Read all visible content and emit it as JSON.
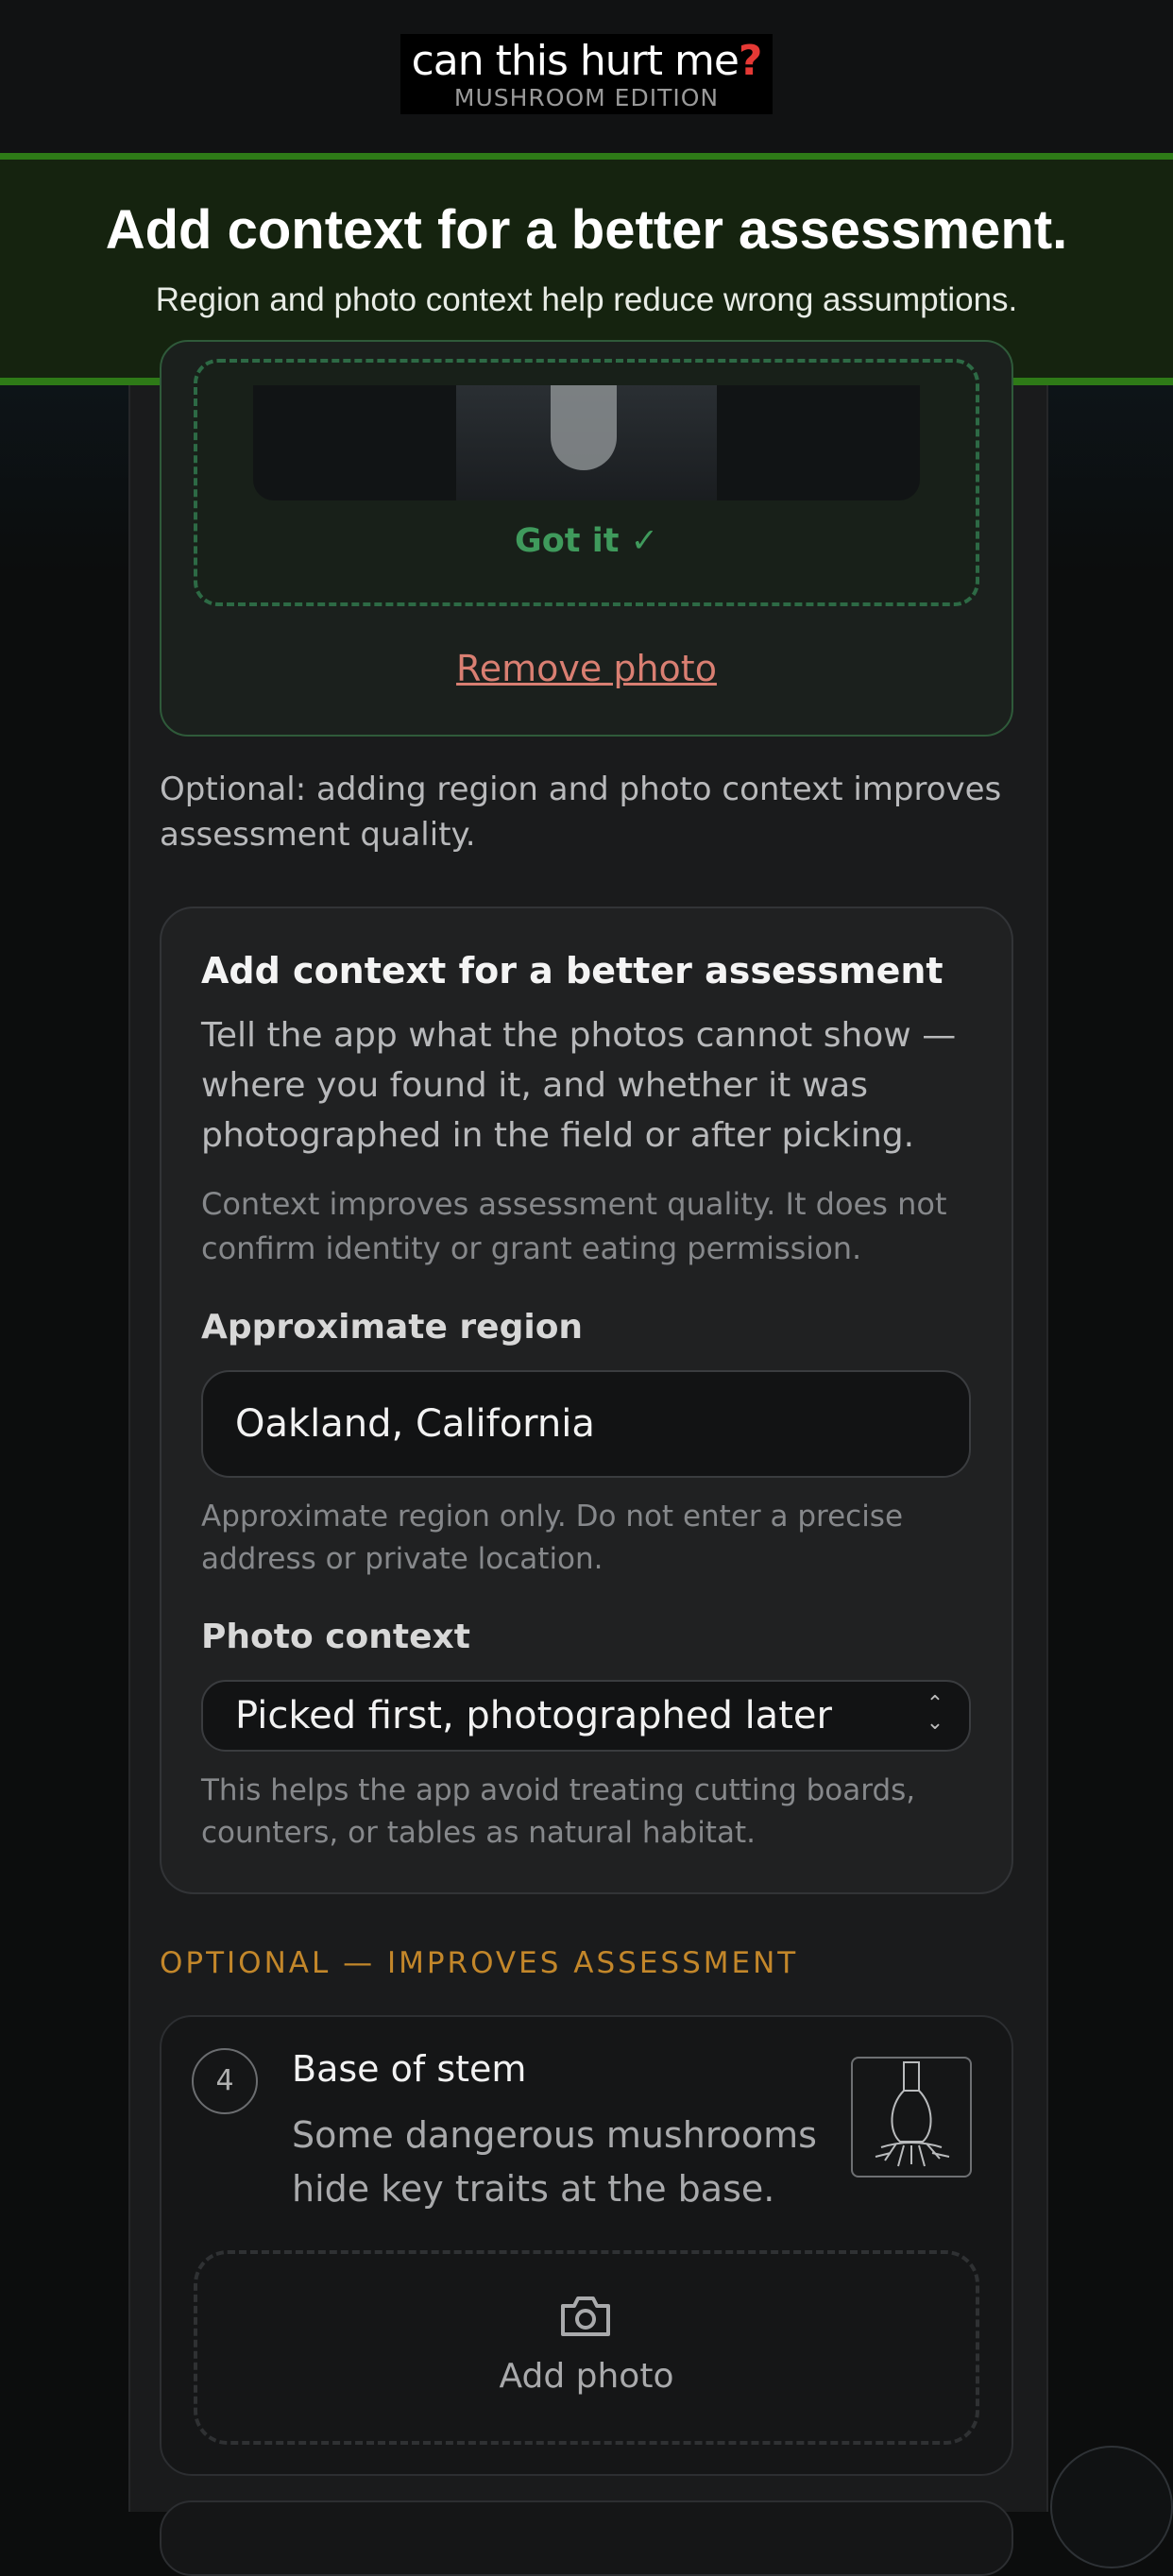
{
  "header": {
    "logo_title": "can this hurt me",
    "logo_question": "?",
    "logo_subtitle": "MUSHROOM EDITION"
  },
  "banner": {
    "title": "Add context for a better assessment.",
    "subtitle": "Region and photo context help reduce wrong assumptions."
  },
  "photo_upload": {
    "status": "Got it ✓",
    "remove_label": "Remove photo"
  },
  "optional_note": "Optional: adding region and photo context improves assessment quality.",
  "context_card": {
    "title": "Add context for a better assessment",
    "description": "Tell the app what the photos cannot show — where you found it, and whether it was photographed in the field or after picking.",
    "note": "Context improves assessment quality. It does not confirm identity or grant eating permission.",
    "region": {
      "label": "Approximate region",
      "value": "Oakland, California",
      "help": "Approximate region only. Do not enter a precise address or private location."
    },
    "photo_context": {
      "label": "Photo context",
      "selected": "Picked first, photographed later",
      "help": "This helps the app avoid treating cutting boards, counters, or tables as natural habitat."
    }
  },
  "optional_section": {
    "heading": "OPTIONAL — IMPROVES ASSESSMENT"
  },
  "step4": {
    "number": "4",
    "title": "Base of stem",
    "description": "Some dangerous mushrooms hide key traits at the base.",
    "add_photo_label": "Add photo"
  },
  "colors": {
    "accent_green": "#2e7a17",
    "success_green": "#3f9a5c",
    "remove_red": "#d97f72",
    "optional_orange": "#c3872a",
    "logo_question": "#e53935"
  }
}
